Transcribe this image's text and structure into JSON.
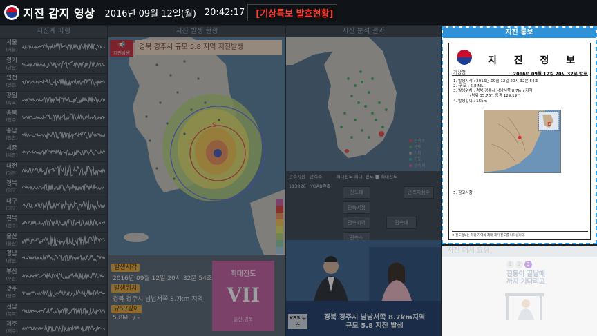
{
  "header": {
    "title": "지진 감지 영상",
    "date": "2016년 09월 12일(월)",
    "time": "20:42:17",
    "alert": "[기상특보 발효현황]"
  },
  "panels": {
    "seismograph": "지진계 파형",
    "occurrence": "지진 발생 현황",
    "analysis": "지진 분석 결과",
    "report": "지진 통보",
    "action": "지진 대처 요령"
  },
  "stations": [
    {
      "name": "서울",
      "sub": "(서울)"
    },
    {
      "name": "경기",
      "sub": "(안산)"
    },
    {
      "name": "인천",
      "sub": "(인천)"
    },
    {
      "name": "강원",
      "sub": "(속초)"
    },
    {
      "name": "충북",
      "sub": "(청주)"
    },
    {
      "name": "충남",
      "sub": "(천안)"
    },
    {
      "name": "세종",
      "sub": "(세종)"
    },
    {
      "name": "대전",
      "sub": "(대전)"
    },
    {
      "name": "경북",
      "sub": "(대구)"
    },
    {
      "name": "대구",
      "sub": "(대구)"
    },
    {
      "name": "전북",
      "sub": "(전주)"
    },
    {
      "name": "울산",
      "sub": "(울산)"
    },
    {
      "name": "경남",
      "sub": "(창원)"
    },
    {
      "name": "부산",
      "sub": "(부산)"
    },
    {
      "name": "광주",
      "sub": "(광주)"
    },
    {
      "name": "전남",
      "sub": "(목포)"
    },
    {
      "name": "제주",
      "sub": "(제주)"
    }
  ],
  "occurrence": {
    "icon_label": "지진발생",
    "banner": "경북 경주시 규모 5.8 지역 지진발생",
    "time_label": "발생시각",
    "time_value": "2016년 09월 12일 20시 32분 54초",
    "location_label": "발생위치",
    "location_value": "경북 경주시 남남서쪽 8.7km 지역",
    "scale_label": "규모/깊이",
    "scale_value": "5.8ML / -",
    "max_intensity_label": "최대진도",
    "max_intensity_value": "VII",
    "max_intensity_region": "울산,경북"
  },
  "analysis": {
    "legend": [
      "관측소",
      "규모",
      "진앙",
      "진도",
      "관측지",
      "관측지점수"
    ],
    "table_head": [
      "관측지점",
      "관측소",
      "최대진도 최대",
      "진앙거리",
      "진도 ■ 최대진도"
    ],
    "row": [
      "113826",
      "YOAB관측"
    ],
    "buttons": [
      "진도대",
      "관측지점수",
      "관측지점",
      "관측지역",
      "관측대",
      "관측소"
    ],
    "news_brand": "KBS 뉴스",
    "news_caption_1": "경북 경주시 남남서쪽 8.7km지역",
    "news_caption_2": "규모 5.8 지진 발생"
  },
  "report": {
    "org": "기상청",
    "title": "지 진 정 보",
    "issued": "2016년 09월 12일 20시 32분 발표",
    "items": [
      "1. 발생시각 : 2016년 09월 12일 20시 32분 54초",
      "2. 규      모 : 5.8 ML",
      "3. 발생위치 : 경북 경주시 남남서쪽 8.7km 지역",
      "(북위 35.76°, 동경 129.19°)",
      "4. 발생깊이 : 15km"
    ],
    "notes": "5. 참고사항",
    "footer": "※ 진도정보는 해당 지역의 최대 계기 진도를 나타냅니다."
  },
  "action": {
    "steps": [
      "1",
      "2",
      "3"
    ],
    "text_1": "진동이 끝날때",
    "text_2": "까지 기다리고"
  },
  "colors": {
    "alert": "#ff3b30",
    "report_accent": "#2f92d8",
    "intensity_box": "#c75fa0",
    "label_tag": "#e7a638"
  }
}
